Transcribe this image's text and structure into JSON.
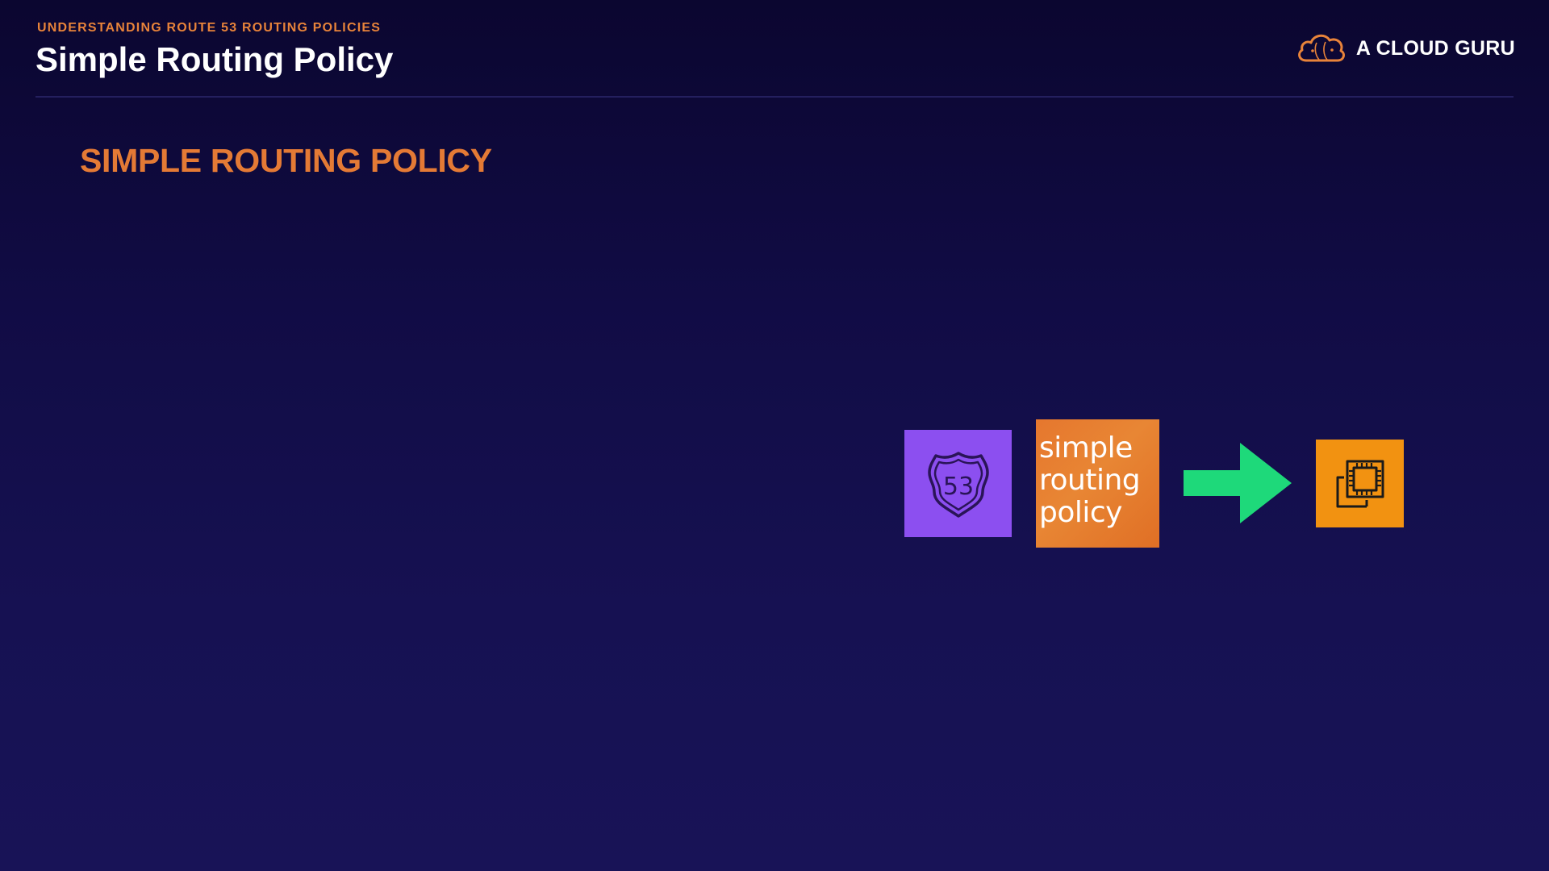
{
  "header": {
    "kicker": "UNDERSTANDING ROUTE 53 ROUTING POLICIES",
    "title": "Simple Routing Policy"
  },
  "brand": {
    "name": "A CLOUD GURU",
    "logo_icon": "cloud-logo-icon"
  },
  "section": {
    "heading": "SIMPLE ROUTING POLICY"
  },
  "diagram": {
    "route53": {
      "icon": "route53-shield-icon",
      "label": "53",
      "color": "#8c4ff0"
    },
    "policy": {
      "lines": [
        "simple",
        "routing",
        "policy"
      ],
      "color": "#e6772e"
    },
    "arrow": {
      "icon": "arrow-right-icon",
      "color": "#1ed97a"
    },
    "ec2": {
      "icon": "ec2-instance-icon",
      "color": "#f29211"
    }
  },
  "colors": {
    "accent": "#e47a35",
    "background": "#120d47"
  }
}
